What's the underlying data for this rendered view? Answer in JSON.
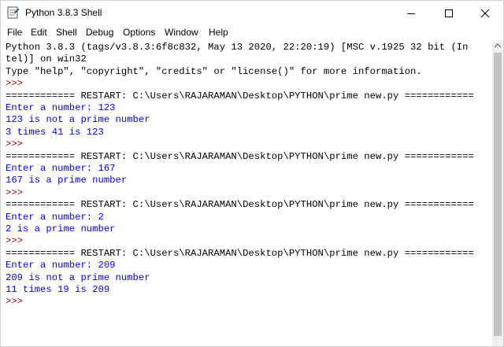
{
  "window": {
    "title": "Python 3.8.3 Shell"
  },
  "menu": [
    "File",
    "Edit",
    "Shell",
    "Debug",
    "Options",
    "Window",
    "Help"
  ],
  "shell": {
    "lines": [
      {
        "text": "Python 3.8.3 (tags/v3.8.3:6f8c832, May 13 2020, 22:20:19) [MSC v.1925 32 bit (In",
        "color": "black"
      },
      {
        "text": "tel)] on win32",
        "color": "black"
      },
      {
        "text": "Type \"help\", \"copyright\", \"credits\" or \"license()\" for more information.",
        "color": "black"
      },
      {
        "text": ">>>",
        "color": "prompt"
      },
      {
        "text": "============ RESTART: C:\\Users\\RAJARAMAN\\Desktop\\PYTHON\\prime new.py ============",
        "color": "black"
      },
      {
        "text": "Enter a number: 123",
        "color": "blue"
      },
      {
        "text": "123 is not a prime number",
        "color": "blue"
      },
      {
        "text": "3 times 41 is 123",
        "color": "blue"
      },
      {
        "text": ">>>",
        "color": "prompt"
      },
      {
        "text": "============ RESTART: C:\\Users\\RAJARAMAN\\Desktop\\PYTHON\\prime new.py ============",
        "color": "black"
      },
      {
        "text": "Enter a number: 167",
        "color": "blue"
      },
      {
        "text": "167 is a prime number",
        "color": "blue"
      },
      {
        "text": ">>>",
        "color": "prompt"
      },
      {
        "text": "============ RESTART: C:\\Users\\RAJARAMAN\\Desktop\\PYTHON\\prime new.py ============",
        "color": "black"
      },
      {
        "text": "Enter a number: 2",
        "color": "blue"
      },
      {
        "text": "2 is a prime number",
        "color": "blue"
      },
      {
        "text": ">>>",
        "color": "prompt"
      },
      {
        "text": "============ RESTART: C:\\Users\\RAJARAMAN\\Desktop\\PYTHON\\prime new.py ============",
        "color": "black"
      },
      {
        "text": "Enter a number: 209",
        "color": "blue"
      },
      {
        "text": "209 is not a prime number",
        "color": "blue"
      },
      {
        "text": "11 times 19 is 209",
        "color": "blue"
      },
      {
        "text": ">>>",
        "color": "prompt"
      }
    ]
  },
  "colors": {
    "output_blue": "#0000ff",
    "prompt": "#8b0000",
    "text": "#000000"
  }
}
